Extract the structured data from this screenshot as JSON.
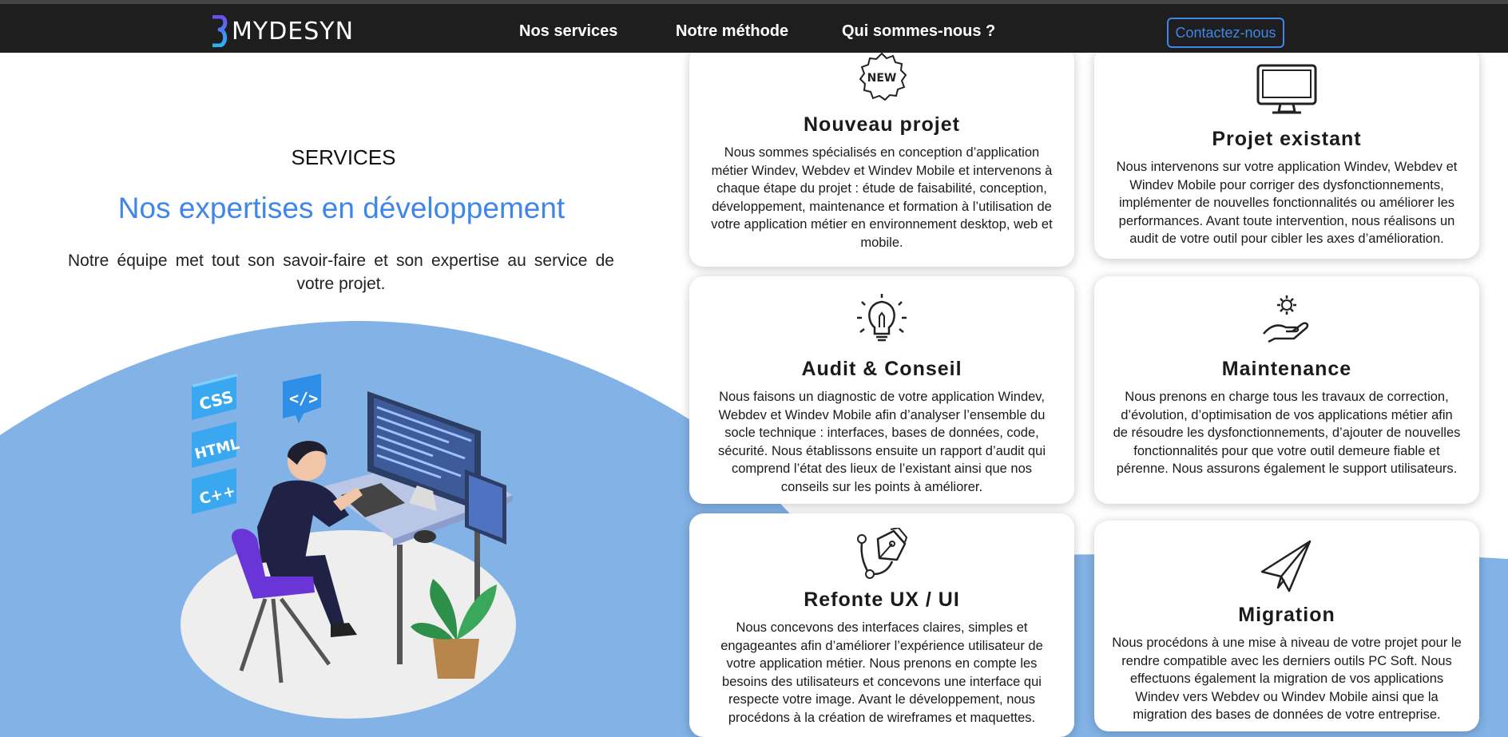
{
  "nav": {
    "logo_text": "MYDESYN",
    "links": [
      "Nos services",
      "Notre méthode",
      "Qui sommes-nous ?"
    ],
    "contact_label": "Contactez-nous"
  },
  "hero": {
    "section_label": "SERVICES",
    "title": "Nos expertises en développement",
    "text": "Notre équipe met tout son savoir-faire et son expertise au service de votre projet."
  },
  "illustration": {
    "badges": [
      "CSS",
      "HTML",
      "C++"
    ]
  },
  "colors": {
    "accent": "#3f86e8",
    "background_shape": "#82b2e6",
    "navbar": "#1e1e1e",
    "chair": "#6a35d6"
  },
  "services": [
    {
      "icon": "new-badge-icon",
      "badge_text": "NEW",
      "title": "Nouveau projet",
      "text": "Nous sommes spécialisés en conception d’application métier Windev, Webdev et Windev Mobile et intervenons à chaque étape du projet : étude de faisabilité, conception, développement, maintenance et formation à l’utilisation de votre application métier en environnement desktop, web et mobile."
    },
    {
      "icon": "monitor-icon",
      "title": "Projet existant",
      "text": "Nous intervenons sur votre application Windev, Webdev et Windev Mobile pour corriger des dysfonctionnements, implémenter de nouvelles fonctionnalités ou améliorer les performances. Avant toute intervention, nous réalisons un audit de votre outil pour cibler les axes d’amélioration."
    },
    {
      "icon": "lightbulb-icon",
      "title": "Audit & Conseil",
      "text": "Nous faisons un diagnostic de votre application Windev, Webdev et Windev Mobile afin d’analyser l’ensemble du socle technique : interfaces, bases de données, code, sécurité. Nous établissons ensuite un rapport d’audit qui comprend l’état des lieux de l’existant ainsi que nos conseils sur les points à améliorer."
    },
    {
      "icon": "gear-hand-icon",
      "title": "Maintenance",
      "text": "Nous prenons en charge tous les travaux de correction, d’évolution, d’optimisation de vos applications métier afin de résoudre les dysfonctionnements, d’ajouter de nouvelles fonctionnalités pour que votre outil demeure fiable et pérenne. Nous assurons également le support utilisateurs."
    },
    {
      "icon": "pen-tool-icon",
      "title": "Refonte UX / UI",
      "text": "Nous concevons des interfaces claires, simples et engageantes afin d’améliorer l’expérience utilisateur de votre application métier. Nous prenons en compte les besoins des utilisateurs et concevons une interface qui respecte votre image. Avant le développement, nous procédons à la création de wireframes et maquettes."
    },
    {
      "icon": "paper-plane-icon",
      "title": "Migration",
      "text": "Nous procédons à une mise à niveau de votre projet pour le rendre compatible avec les derniers outils PC Soft. Nous effectuons également la migration de vos applications Windev vers Webdev ou Windev Mobile ainsi que la migration des bases de données de votre entreprise."
    }
  ]
}
